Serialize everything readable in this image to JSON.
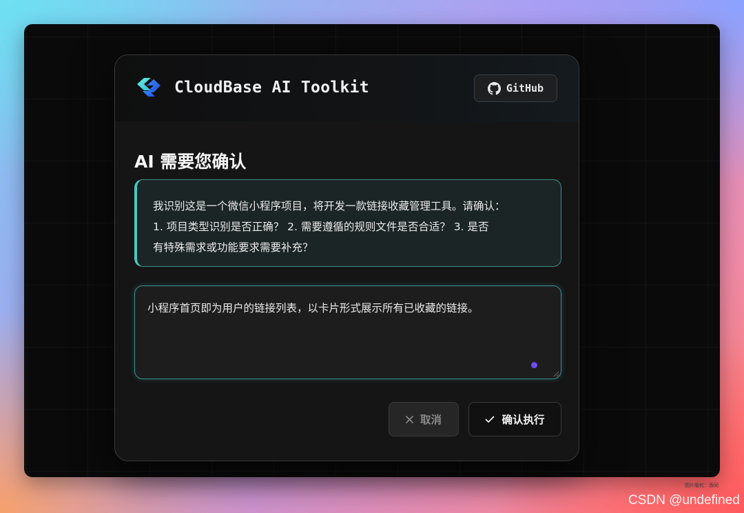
{
  "app": {
    "title": "CloudBase AI Toolkit",
    "github_label": "GitHub",
    "logo_icon": "cloudbase-logo-icon",
    "github_icon": "github-icon"
  },
  "dialog": {
    "title": "AI 需要您确认",
    "message_lines": [
      "我识别这是一个微信小程序项目，将开发一款链接收藏管理工具。请确认：",
      "1. 项目类型识别是否正确？ 2. 需要遵循的规则文件是否合适？ 3. 是否",
      "有特殊需求或功能要求需要补充？"
    ],
    "reply_value": "小程序首页即为用户的链接列表，以卡片形式展示所有已收藏的链接。",
    "cancel_label": "取消",
    "confirm_label": "确认执行",
    "cancel_icon": "close-icon",
    "confirm_icon": "check-icon"
  },
  "footer": {
    "copyright": "图片版权：香同",
    "watermark": "CSDN @undefined"
  },
  "colors": {
    "accent": "#47c9c1",
    "dot": "#6d4cf5",
    "dialog_bg": "#151515",
    "backdrop_bg": "#0a0a0a"
  }
}
